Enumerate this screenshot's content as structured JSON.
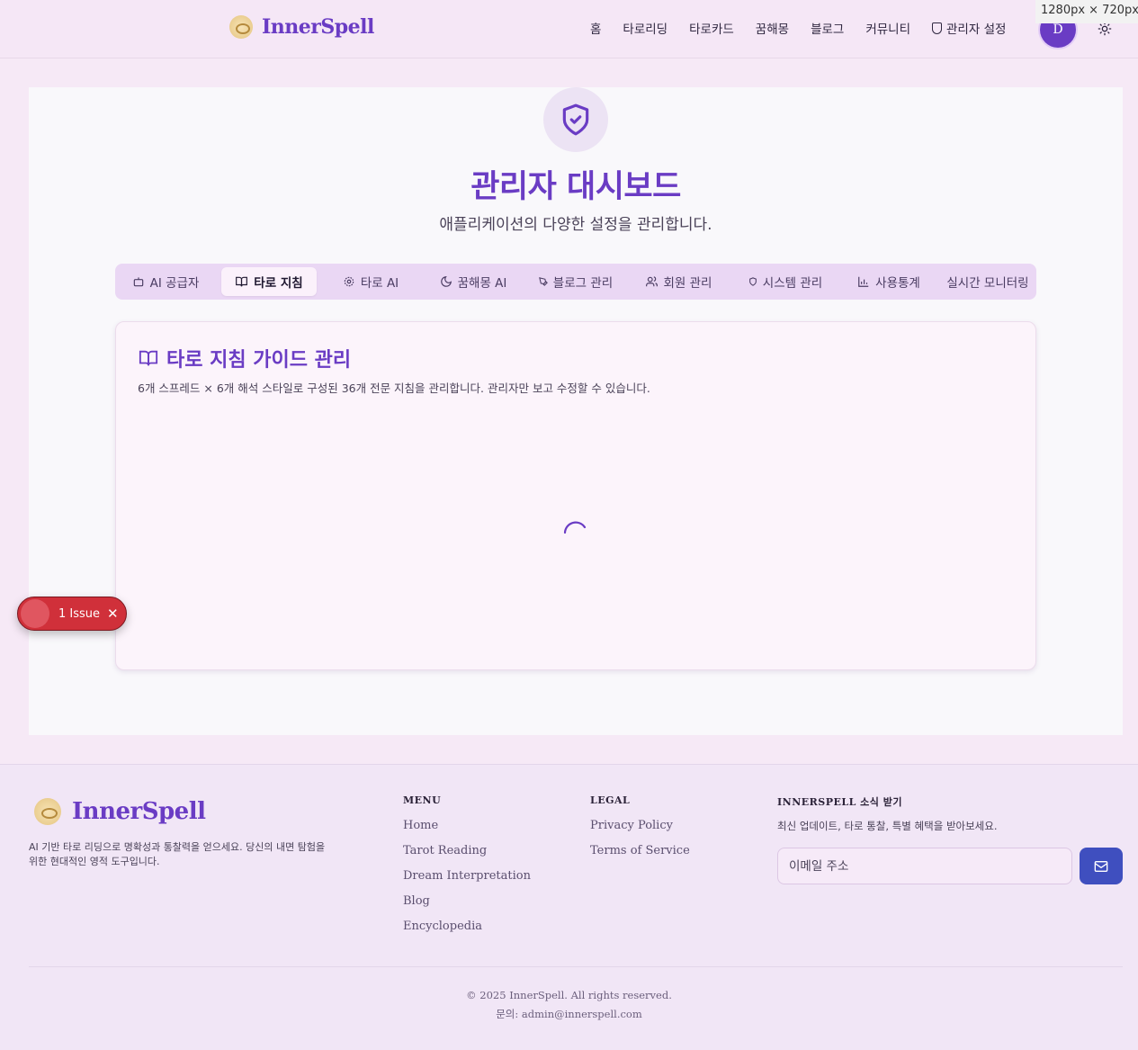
{
  "viewport_badge": "1280px × 720px",
  "header": {
    "brand": "InnerSpell",
    "nav": [
      "홈",
      "타로리딩",
      "타로카드",
      "꿈해몽",
      "블로그",
      "커뮤니티"
    ],
    "admin_link": "관리자 설정",
    "avatar_initial": "D"
  },
  "dashboard": {
    "title": "관리자 대시보드",
    "subtitle": "애플리케이션의 다양한 설정을 관리합니다.",
    "tabs": [
      {
        "label": "AI 공급자",
        "icon": "bot-icon"
      },
      {
        "label": "타로 지침",
        "icon": "book-open-icon",
        "active": true
      },
      {
        "label": "타로 AI",
        "icon": "cog-icon"
      },
      {
        "label": "꿈해몽 AI",
        "icon": "moon-icon"
      },
      {
        "label": "블로그 관리",
        "icon": "pen-nib-icon"
      },
      {
        "label": "회원 관리",
        "icon": "users-icon"
      },
      {
        "label": "시스템 관리",
        "icon": "shield-icon"
      },
      {
        "label": "사용통계",
        "icon": "bar-chart-icon"
      },
      {
        "label": "실시간 모니터링",
        "icon": "activity-icon"
      }
    ],
    "card": {
      "title": "타로 지침 가이드 관리",
      "description": "6개 스프레드 × 6개 해석 스타일로 구성된 36개 전문 지침을 관리합니다. 관리자만 보고 수정할 수 있습니다."
    }
  },
  "issue_badge": {
    "label": "1 Issue"
  },
  "footer": {
    "brand": "InnerSpell",
    "about": "AI 기반 타로 리딩으로 명확성과 통찰력을 얻으세요. 당신의 내면 탐험을 위한 현대적인 영적 도구입니다.",
    "menu_title": "MENU",
    "menu_links": [
      "Home",
      "Tarot Reading",
      "Dream Interpretation",
      "Blog",
      "Encyclopedia"
    ],
    "legal_title": "LEGAL",
    "legal_links": [
      "Privacy Policy",
      "Terms of Service"
    ],
    "newsletter_title": "INNERSPELL 소식 받기",
    "newsletter_desc": "최신 업데이트, 타로 통찰, 특별 혜택을 받아보세요.",
    "email_placeholder": "이메일 주소",
    "copyright": "© 2025 InnerSpell. All rights reserved.",
    "contact": "문의: admin@innerspell.com"
  },
  "colors": {
    "brand": "#6a3cc4",
    "page_bg": "#f6e9f6",
    "send_button": "#3f4fbf",
    "issue": "#d0303a"
  }
}
